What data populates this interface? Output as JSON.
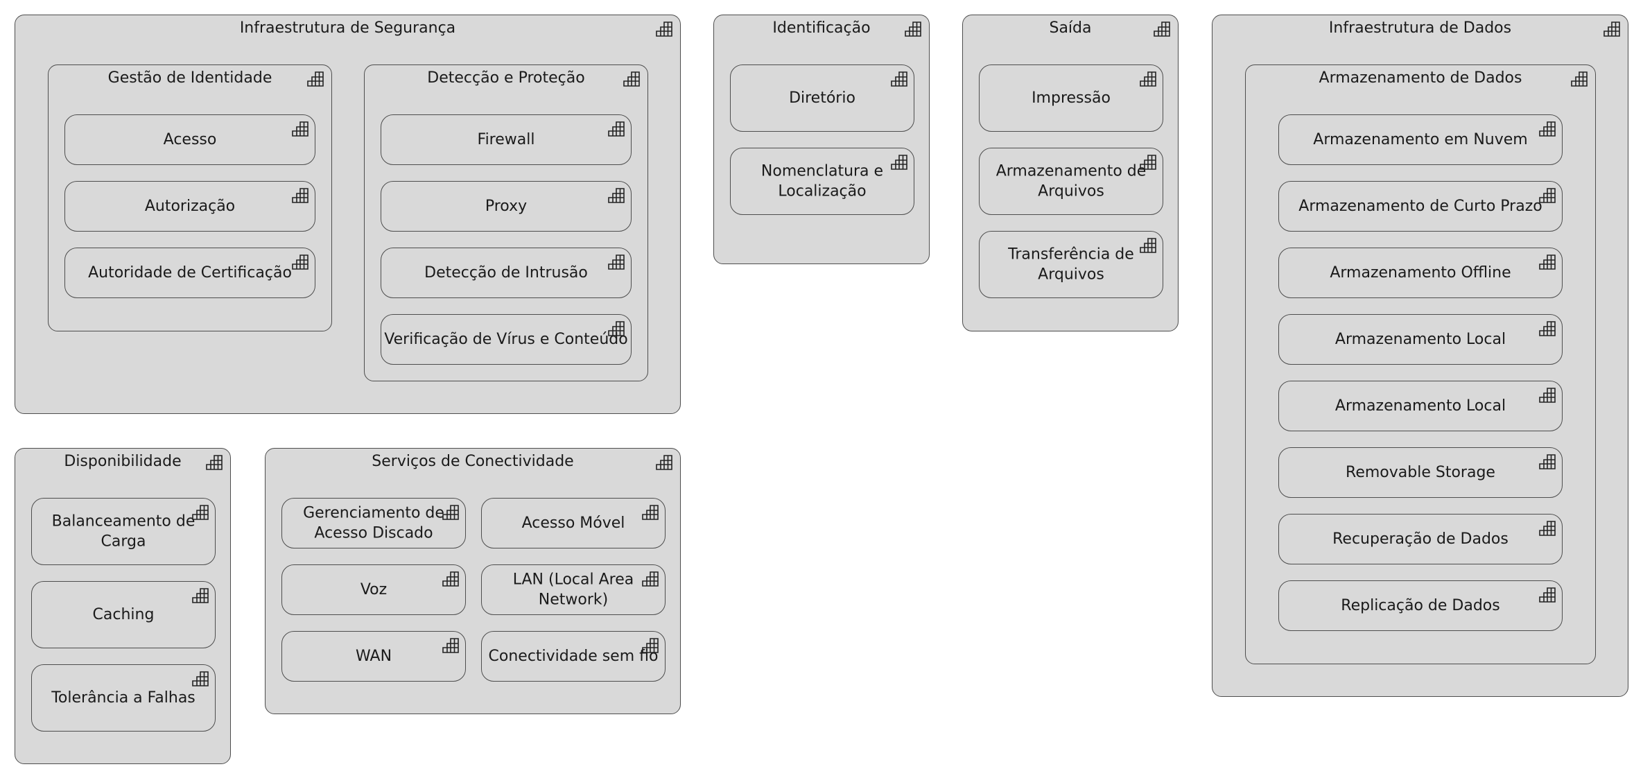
{
  "diagram": {
    "groups": {
      "infra_seguranca": {
        "title": "Infraestrutura de Segurança"
      },
      "gestao_identidade": {
        "title": "Gestão de Identidade",
        "items": [
          "Acesso",
          "Autorização",
          "Autoridade de Certificação"
        ]
      },
      "deteccao_protecao": {
        "title": "Detecção e Proteção",
        "items": [
          "Firewall",
          "Proxy",
          "Detecção de Intrusão",
          "Verificação de Vírus e Conteúdo"
        ]
      },
      "identificacao": {
        "title": "Identificação",
        "items": [
          "Diretório",
          "Nomenclatura e\nLocalização"
        ]
      },
      "saida": {
        "title": "Saída",
        "items": [
          "Impressão",
          "Armazenamento de\nArquivos",
          "Transferência de\nArquivos"
        ]
      },
      "infra_dados": {
        "title": "Infraestrutura de Dados"
      },
      "armazenamento_dados": {
        "title": "Armazenamento de Dados",
        "items": [
          "Armazenamento em Nuvem",
          "Armazenamento de Curto Prazo",
          "Armazenamento Offline",
          "Armazenamento Local",
          "Armazenamento Local",
          "Removable Storage",
          "Recuperação de Dados",
          "Replicação de Dados"
        ]
      },
      "disponibilidade": {
        "title": "Disponibilidade",
        "items": [
          "Balanceamento de\nCarga",
          "Caching",
          "Tolerância a Falhas"
        ]
      },
      "conectividade": {
        "title": "Serviços de Conectividade",
        "items": [
          "Gerenciamento de\nAcesso Discado",
          "Acesso Móvel",
          "Voz",
          "LAN (Local Area\nNetwork)",
          "WAN",
          "Conectividade sem fio"
        ]
      }
    },
    "icon": "component-grid-icon",
    "colors": {
      "fill": "#d9d9d9",
      "border": "#4d4d4d",
      "text": "#1a1a1a"
    }
  }
}
